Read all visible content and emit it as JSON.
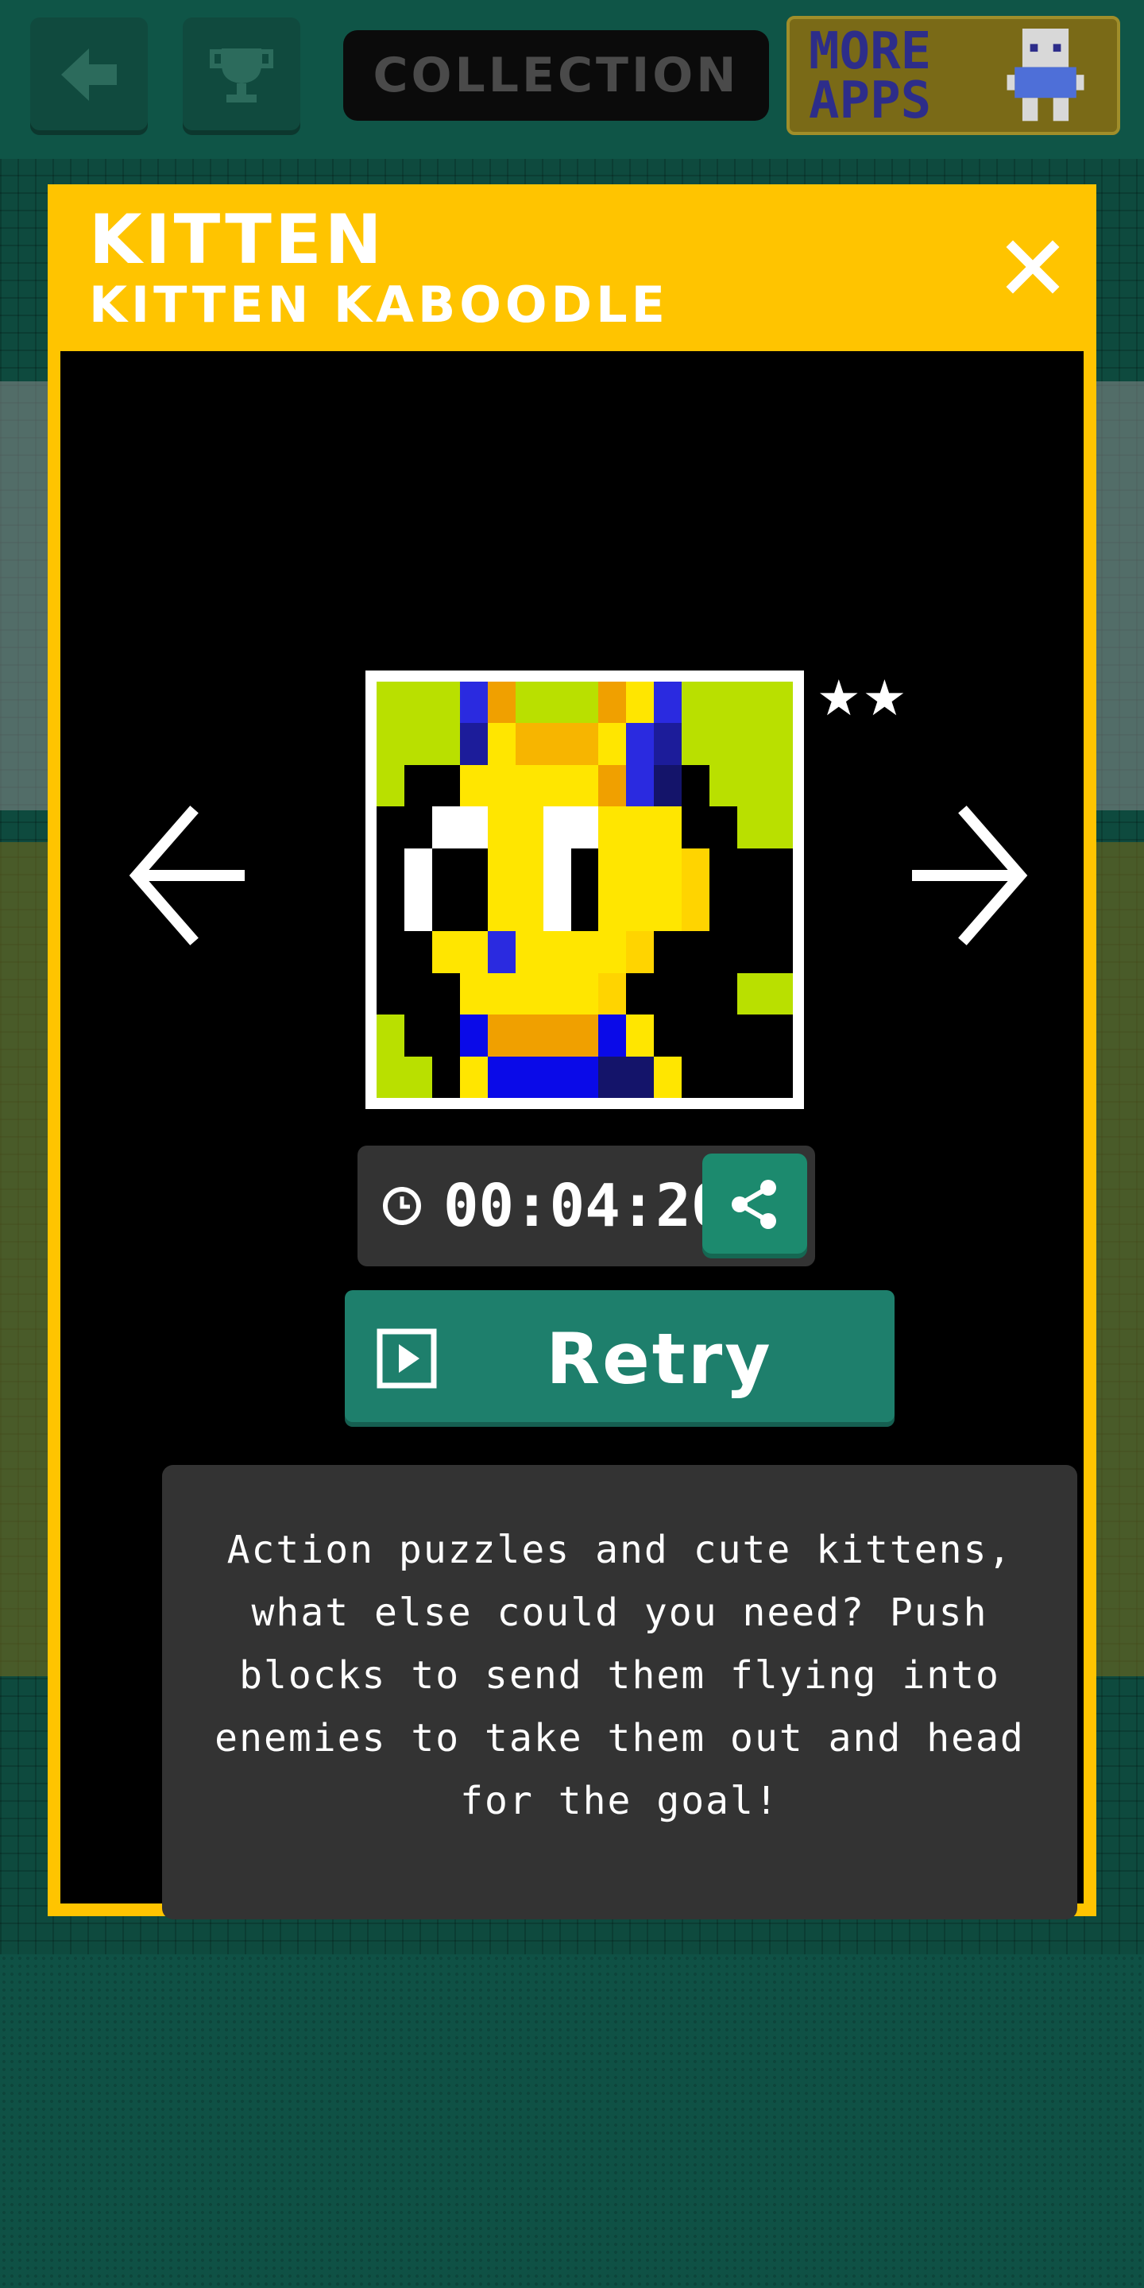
{
  "topbar": {
    "back_icon": "back-arrow-icon",
    "trophy_icon": "trophy-icon",
    "title": "COLLECTION",
    "more_apps_label": "MORE APPS"
  },
  "modal": {
    "title": "KITTEN",
    "subtitle": "KITTEN KABOODLE",
    "close_icon": "close-icon",
    "prev_icon": "arrow-left-icon",
    "next_icon": "arrow-right-icon",
    "stars": "★★",
    "timer": "00:04:20",
    "timer_icon": "clock-icon",
    "share_icon": "share-icon",
    "retry_label": "Retry",
    "retry_icon": "play-icon",
    "description": "Action puzzles and cute kittens, what else could you need? Push blocks to send them flying into enemies to take them out and head for the goal!"
  },
  "colors": {
    "accent_yellow": "#ffc400",
    "button_green": "#1e7f6c",
    "panel_gray": "#333333",
    "background_green": "#0f4d40"
  },
  "pixel_art": {
    "palette": {
      "G": "#b9e000",
      "B": "#2a2ae0",
      "D": "#1c1c9a",
      "N": "#14146a",
      "O": "#f0a000",
      "o": "#f7b500",
      "Y": "#ffe600",
      "y": "#ffd400",
      "W": "#ffffff",
      "K": "#000000",
      "U": "#0a0ae8"
    },
    "rows": [
      "GGGBOGGGOYBGGGG",
      "GGGDYoooYBDGGGG",
      "GKKYYYYYOBNKGGG",
      "KKWWYYWWYYYKKGG",
      "KWKKYYWKYYYyKKK",
      "KWKKYYWKYYYyKKK",
      "KKYYBYYYYyKKKKK",
      "KKKYYYYYyKKKKGG",
      "GKKUOOOOUYKKKKK",
      "GGKYUUUUNNYKKKK"
    ]
  }
}
